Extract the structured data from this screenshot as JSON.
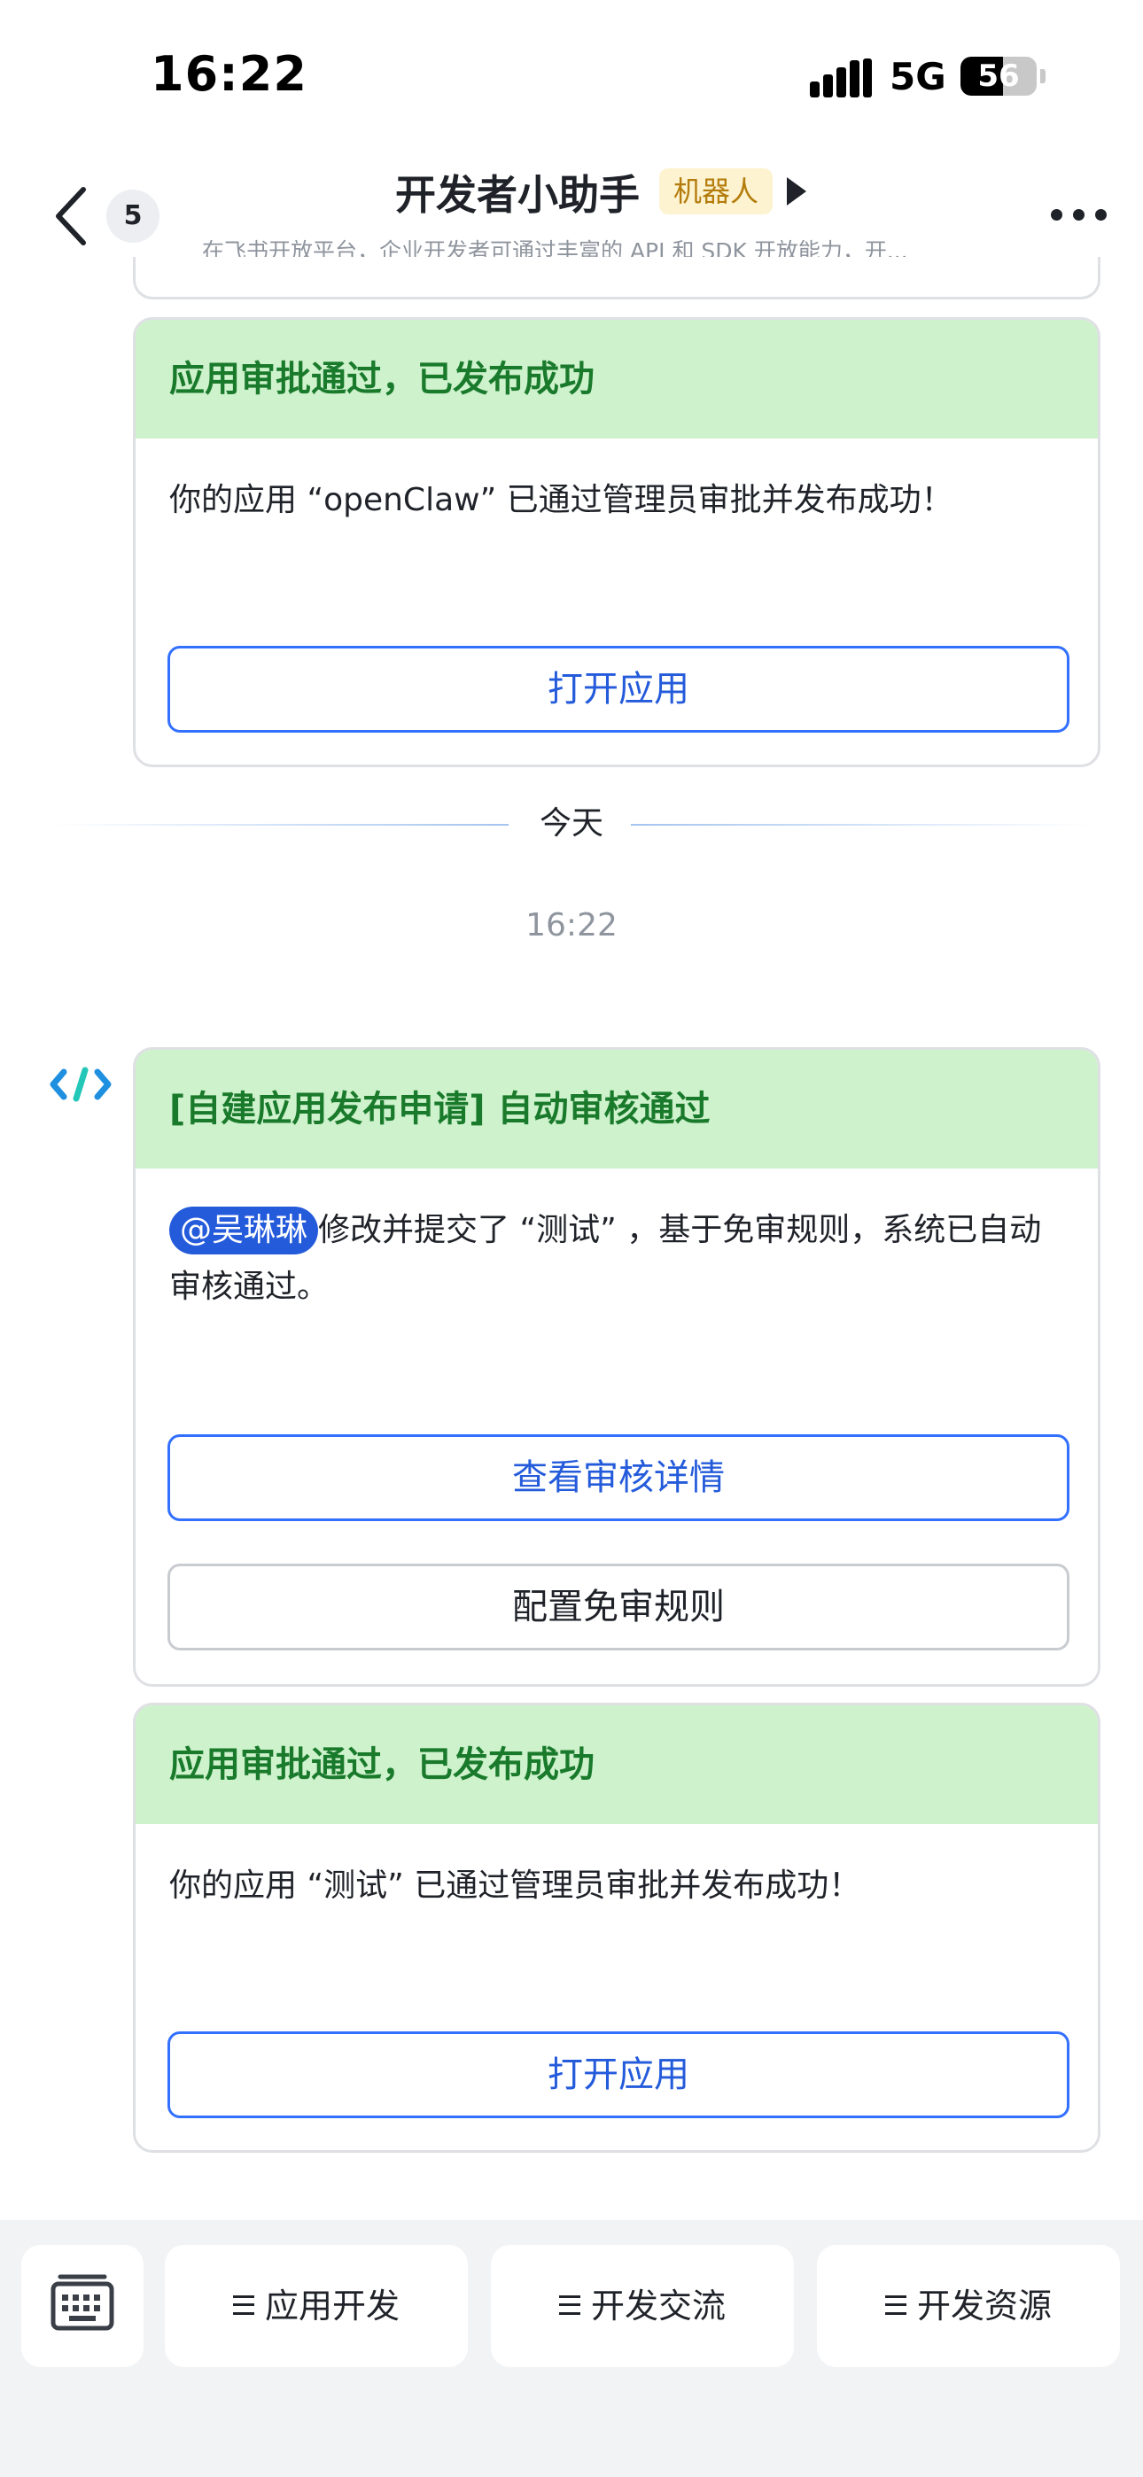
{
  "status_bar": {
    "time": "16:22",
    "network": "5G",
    "battery": "56",
    "battery_level": 0.56
  },
  "nav": {
    "unread_count": "5",
    "title": "开发者小助手",
    "badge": "机器人",
    "description": "在飞书开放平台，企业开发者可通过丰富的 API 和 SDK 开放能力，开..."
  },
  "messages": {
    "card1": {
      "header": "应用审批通过，已发布成功",
      "body": "你的应用 “openClaw” 已通过管理员审批并发布成功！",
      "button": "打开应用"
    },
    "divider": "今天",
    "timestamp": "16:22",
    "card2": {
      "header": "[自建应用发布申请] 自动审核通过",
      "mention": "@吴琳琳",
      "body": "修改并提交了 “测试” ，基于免审规则，系统已自动审核通过。",
      "button_primary": "查看审核详情",
      "button_secondary": "配置免审规则"
    },
    "card3": {
      "header": "应用审批通过，已发布成功",
      "body": "你的应用 “测试” 已通过管理员审批并发布成功！",
      "button": "打开应用"
    }
  },
  "bottom_menu": {
    "items": [
      {
        "label": "应用开发"
      },
      {
        "label": "开发交流"
      },
      {
        "label": "开发资源"
      }
    ]
  },
  "colors": {
    "accent": "#245bdb",
    "card_header_bg": "#cdf2cc",
    "card_header_text": "#1a7a2c",
    "badge_bg": "#fdf3d0",
    "badge_text": "#b47c0c"
  },
  "icons": {
    "back": "chevron-left-icon",
    "more": "more-horizontal-icon",
    "keyboard": "keyboard-icon",
    "menu": "hamburger-menu-icon",
    "bot": "developer-bot-logo-icon"
  }
}
